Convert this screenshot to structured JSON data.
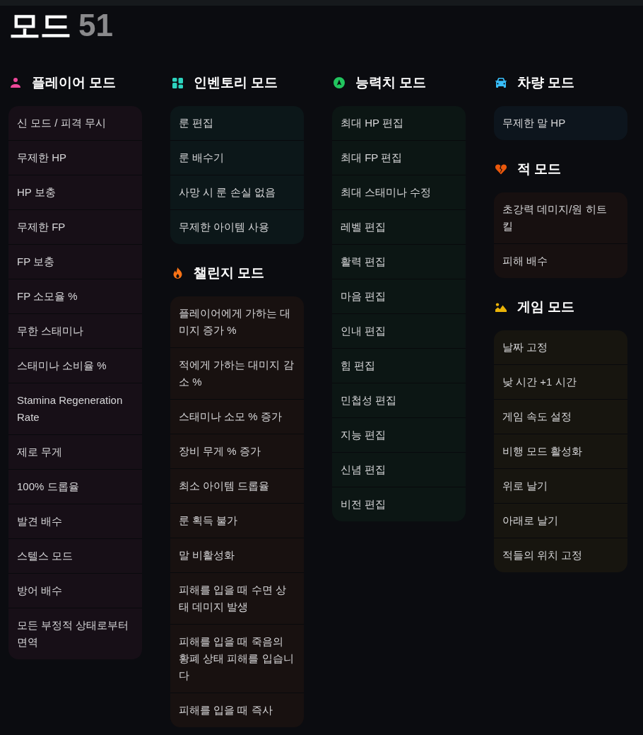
{
  "title": "모드",
  "count": "51",
  "columns": [
    {
      "sections": [
        {
          "kind": "player",
          "name": "플레이어 모드",
          "color": "#ec4899",
          "items": [
            "신 모드 / 피격 무시",
            "무제한 HP",
            "HP 보충",
            "무제한 FP",
            "FP 보충",
            "FP 소모율 %",
            "무한 스태미나",
            "스태미나 소비율 %",
            "Stamina Regeneration Rate",
            "제로 무게",
            "100% 드롭율",
            "발견 배수",
            "스텔스 모드",
            "방어 배수",
            "모든 부정적 상태로부터 면역"
          ]
        }
      ]
    },
    {
      "sections": [
        {
          "kind": "inventory",
          "name": "인벤토리 모드",
          "color": "#2dd4bf",
          "items": [
            "룬 편집",
            "룬 배수기",
            "사망 시 룬 손실 없음",
            "무제한 아이템 사용"
          ]
        },
        {
          "kind": "challenge",
          "name": "챌린지 모드",
          "color": "#f97316",
          "items": [
            "플레이어에게 가하는 대미지 증가 %",
            "적에게 가하는 대미지 감소 %",
            "스태미나 소모 % 증가",
            "장비 무게 % 증가",
            "최소 아이템 드롭율",
            "룬 획득 불가",
            "말 비활성화",
            "피해를 입을 때 수면 상태 데미지 발생",
            "피해를 입을 때 죽음의 황폐 상태 피해를 입습니다",
            "피해를 입을 때 즉사"
          ]
        }
      ]
    },
    {
      "sections": [
        {
          "kind": "stats",
          "name": "능력치 모드",
          "color": "#22c55e",
          "items": [
            "최대 HP 편집",
            "최대 FP 편집",
            "최대 스태미나 수정",
            "레벨 편집",
            "활력 편집",
            "마음 편집",
            "인내 편집",
            "힘 편집",
            "민첩성 편집",
            "지능 편집",
            "신념 편집",
            "비전 편집"
          ]
        }
      ]
    },
    {
      "sections": [
        {
          "kind": "vehicle",
          "name": "차량 모드",
          "color": "#38bdf8",
          "items": [
            "무제한 말 HP"
          ]
        },
        {
          "kind": "enemy",
          "name": "적 모드",
          "color": "#ea580c",
          "items": [
            "초강력 데미지/원 히트 킬",
            "피해 배수"
          ]
        },
        {
          "kind": "game",
          "name": "게임 모드",
          "color": "#eab308",
          "items": [
            "날짜 고정",
            "낮 시간 +1 시간",
            "게임 속도 설정",
            "비행 모드 활성화",
            "위로 날기",
            "아래로 날기",
            "적들의 위치 고정"
          ]
        }
      ]
    }
  ]
}
